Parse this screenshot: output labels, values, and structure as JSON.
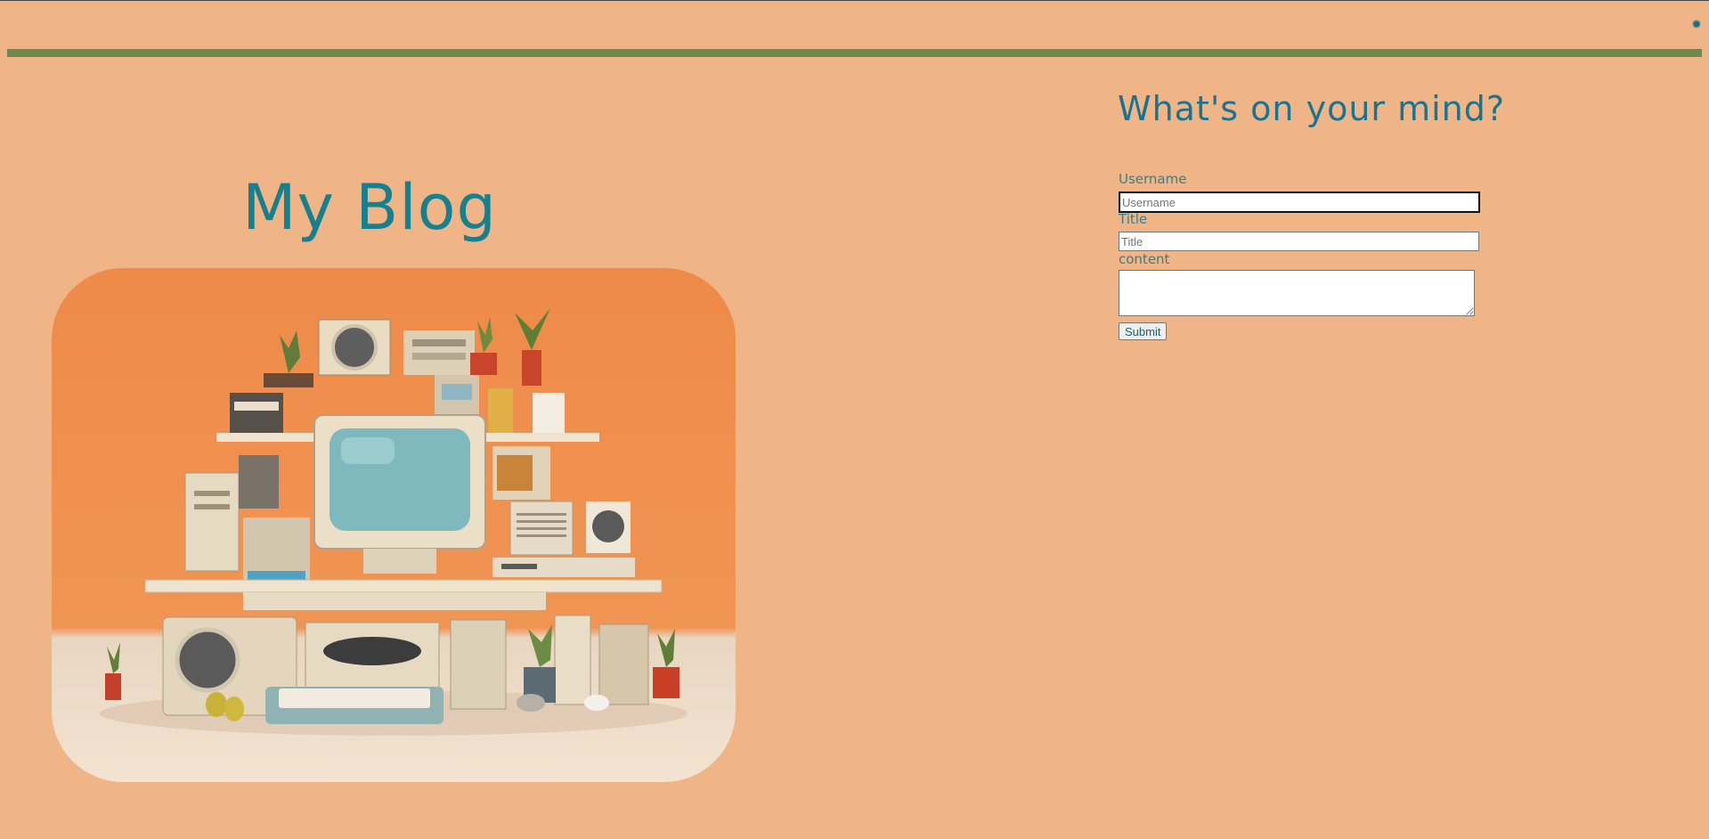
{
  "header": {
    "theme_toggle_icon": "sun-icon",
    "theme_toggle_glyph": "✹"
  },
  "hero": {
    "title": "My Blog",
    "image_alt_icon": "retro-computer-illustration"
  },
  "form": {
    "heading": "What's on your mind?",
    "username_label": "Username",
    "username_placeholder": "Username",
    "username_value": "",
    "title_label": "Title",
    "title_placeholder": "Title",
    "title_value": "",
    "content_label": "content",
    "content_value": "",
    "submit_label": "Submit"
  },
  "colors": {
    "background": "#f0b586",
    "accent_bar": "#6b8a4e",
    "heading_teal": "#16808f",
    "label_teal": "#3f7c84"
  }
}
